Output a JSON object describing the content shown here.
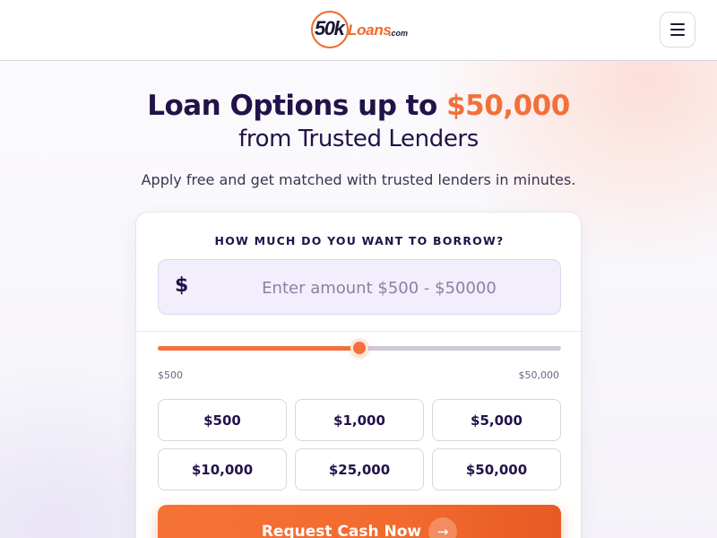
{
  "header": {
    "logo": {
      "number": "50k",
      "word": "Loans",
      "domain": ".com"
    },
    "menu_icon": "hamburger-menu-icon"
  },
  "hero": {
    "title_prefix": "Loan Options up to ",
    "title_accent": "$50,000",
    "subtitle": "from Trusted Lenders",
    "description": "Apply free and get matched with trusted lenders in minutes."
  },
  "form": {
    "question": "HOW MUCH DO YOU WANT TO BORROW?",
    "currency_symbol": "$",
    "amount_placeholder": "Enter amount $500 - $50000",
    "amount_value": "",
    "slider": {
      "min_label": "$500",
      "max_label": "$50,000",
      "fill_fraction": 0.5
    },
    "presets": [
      "$500",
      "$1,000",
      "$5,000",
      "$10,000",
      "$25,000",
      "$50,000"
    ],
    "submit_label": "Request Cash Now",
    "submit_icon": "arrow-right-icon"
  },
  "colors": {
    "accent": "#f3703a",
    "brand_dark": "#22124a",
    "input_bg": "#f2eefb"
  }
}
